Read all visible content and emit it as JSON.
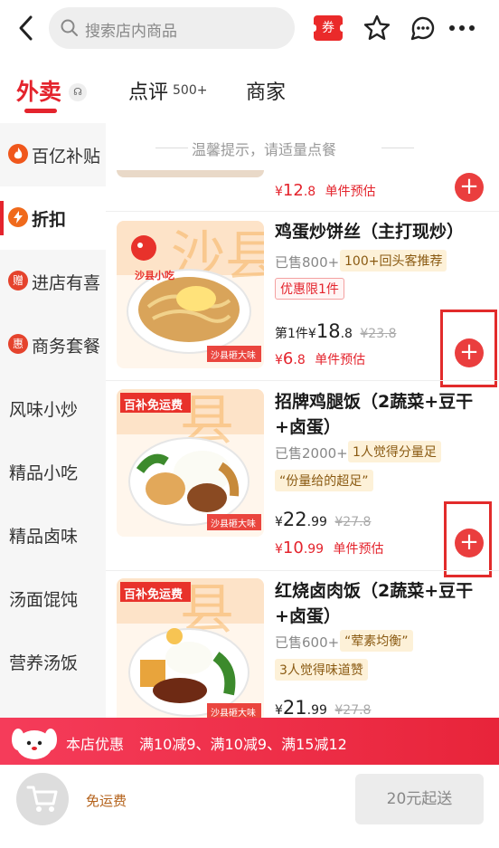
{
  "header": {
    "search_placeholder": "搜索店内商品",
    "coupon_label": "券"
  },
  "tabs": {
    "waimai": "外卖",
    "waimai_badge": "☊",
    "dianping": "点评",
    "dianping_count": "500+",
    "shangjia": "商家"
  },
  "sidebar": {
    "items": [
      {
        "label": "百亿补贴",
        "icon": "flame-icon"
      },
      {
        "label": "折扣",
        "icon": "bolt-icon"
      },
      {
        "label": "进店有喜",
        "icon_text": "赠"
      },
      {
        "label": "商务套餐",
        "icon_text": "惠"
      },
      {
        "label": "风味小炒"
      },
      {
        "label": "精品小吃"
      },
      {
        "label": "精品卤味"
      },
      {
        "label": "汤面馄饨"
      },
      {
        "label": "营养汤饭"
      }
    ]
  },
  "main": {
    "tip": "温馨提示，请适量点餐",
    "partial": {
      "est_symbol": "¥",
      "est_int": "12",
      "est_dec": ".8",
      "est_label": "单件预估"
    },
    "dishes": [
      {
        "name": "鸡蛋炒饼丝（主打现炒）",
        "sold": "已售800+",
        "tag": "100+回头客推荐",
        "limit": "优惠限1件",
        "price_prefix": "第1件",
        "price_symbol": "¥",
        "price_int": "18",
        "price_dec": ".8",
        "original": "¥23.8",
        "est_symbol": "¥",
        "est_int": "6",
        "est_dec": ".8",
        "est_label": "单件预估",
        "img_text": "沙县小吃",
        "img_sub": "沙县砸大味"
      },
      {
        "name": "招牌鸡腿饭（2蔬菜+豆干+卤蛋）",
        "sold": "已售2000+",
        "tag": "1人觉得分量足",
        "quote": "“份量给的超足”",
        "price_symbol": "¥",
        "price_int": "22",
        "price_dec": ".99",
        "original": "¥27.8",
        "est_symbol": "¥",
        "est_int": "10",
        "est_dec": ".99",
        "est_label": "单件预估",
        "img_badge": "百补免运费",
        "img_sub": "沙县砸大味"
      },
      {
        "name": "红烧卤肉饭（2蔬菜+豆干+卤蛋）",
        "sold": "已售600+",
        "quote": "“荤素均衡”",
        "tag": "3人觉得味道赞",
        "price_symbol": "¥",
        "price_int": "21",
        "price_dec": ".99",
        "original": "¥27.8",
        "img_badge": "百补免运费",
        "img_sub": "沙县砸大味"
      }
    ]
  },
  "promo": {
    "title": "本店优惠",
    "detail": "满10减9、满10减9、满15减12"
  },
  "bottom": {
    "free_delivery": "免运费",
    "min_order": "20元起送"
  },
  "colors": {
    "brand_red": "#e4242d",
    "tag_bg": "#fdf1d8",
    "promo_bg": "#f53c5a"
  }
}
